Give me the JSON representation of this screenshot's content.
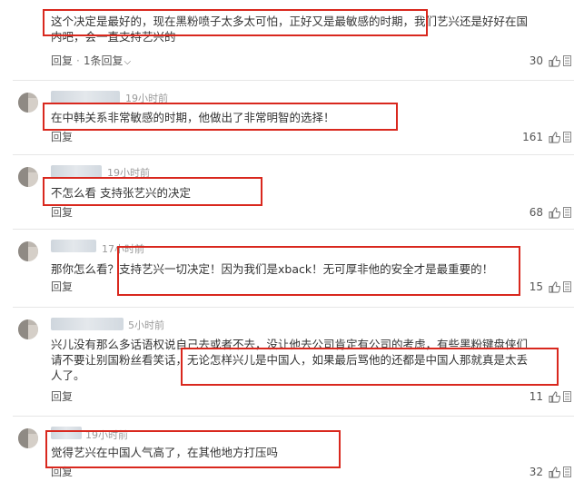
{
  "colors": {
    "highlight_border": "#d9281e",
    "text": "#333333",
    "meta": "#9a9a9a",
    "separator": "#e6e6e6"
  },
  "icons": {
    "like": "thumbs-up-icon",
    "report": "report-icon",
    "expand": "chevron-down-icon"
  },
  "comments": [
    {
      "time": "",
      "lines": [
        "这个决定是最好的，现在黑粉喷子太多太可怕，正好又是最敏感的时期，我们艺兴还是好好在国",
        "内吧，会一直支持艺兴的"
      ],
      "reply_label": "回复",
      "separator_dot": "·",
      "replies_label": "1条回复",
      "likes": "30"
    },
    {
      "time": "19小时前",
      "lines": [
        "在中韩关系非常敏感的时期，他做出了非常明智的选择！"
      ],
      "reply_label": "回复",
      "likes": "161"
    },
    {
      "time": "19小时前",
      "lines": [
        "不怎么看 支持张艺兴的决定"
      ],
      "reply_label": "回复",
      "likes": "68"
    },
    {
      "time": "17小时前",
      "lines": [
        "那你怎么看？支持艺兴一切决定！因为我们是xback！无可厚非他的安全才是最重要的！"
      ],
      "reply_label": "回复",
      "likes": "15"
    },
    {
      "time": "5小时前",
      "lines": [
        "兴儿没有那么多话语权说自己去或者不去，没让他去公司肯定有公司的考虑，有些黑粉键盘侠们",
        "请不要让别国粉丝看笑话，无论怎样兴儿是中国人，如果最后骂他的还都是中国人那就真是太丢",
        "人了。"
      ],
      "reply_label": "回复",
      "likes": "11"
    },
    {
      "time": "19小时前",
      "lines": [
        "觉得艺兴在中国人气高了，在其他地方打压吗"
      ],
      "reply_label": "回复",
      "likes": "32"
    }
  ]
}
